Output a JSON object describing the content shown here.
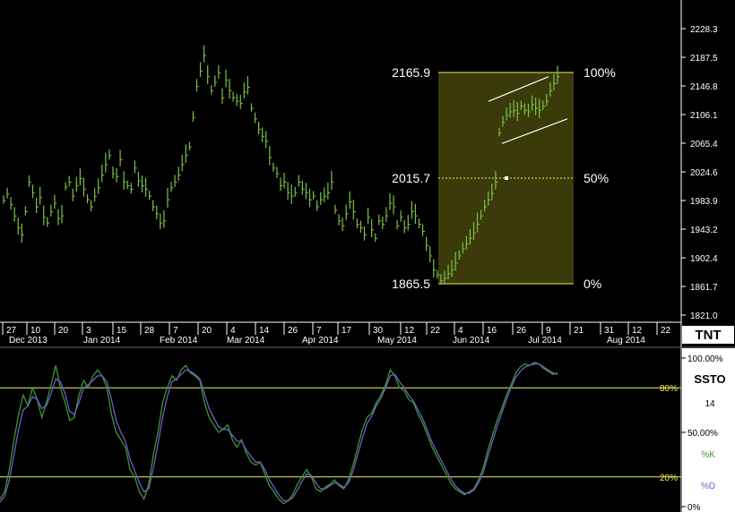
{
  "chart_data": [
    {
      "type": "bar",
      "style": "ohlc-bars",
      "bar_color": "#7cc24a",
      "ylim": [
        1821.0,
        2269.0
      ],
      "y_ticks": [
        "2228.3",
        "2187.5",
        "2146.8",
        "2106.1",
        "2065.4",
        "2024.6",
        "1983.9",
        "1943.2",
        "1902.4",
        "1861.7",
        "1821.0"
      ],
      "x_day_ticks": [
        "27",
        "10",
        "20",
        "3",
        "15",
        "28",
        "7",
        "20",
        "4",
        "14",
        "26",
        "7",
        "17",
        "30",
        "12",
        "22",
        "4",
        "16",
        "26",
        "9",
        "21",
        "31",
        "12",
        "22"
      ],
      "x_month_labels": [
        "Dec 2013",
        "Jan 2014",
        "Feb 2014",
        "Mar 2014",
        "Apr 2014",
        "May 2014",
        "Jun 2014",
        "Jul 2014",
        "Aug 2014"
      ],
      "fibonacci": {
        "levels": [
          {
            "price": "2165.9",
            "pct": "100%"
          },
          {
            "price": "2015.7",
            "pct": "50%"
          },
          {
            "price": "1865.5",
            "pct": "0%"
          }
        ],
        "zone_color": "#3a3a0a",
        "line_color": "#f0f060"
      },
      "channel": {
        "upper": [
          [
            2106.1,
            2165.9
          ]
        ],
        "lower": [
          [
            2065.4,
            2106.1
          ]
        ]
      },
      "price_series": [
        1983.9,
        1993,
        1978,
        1962,
        1945,
        1935,
        1968,
        2010,
        1995,
        1975,
        1988,
        1960,
        1952,
        1968,
        1980,
        1958,
        1962,
        2003,
        2010,
        1990,
        2005,
        2015,
        2000,
        1985,
        1975,
        1990,
        2002,
        2020,
        2035,
        2048,
        2022,
        2018,
        2042,
        2010,
        2005,
        2000,
        2030,
        2012,
        2005,
        2000,
        1990,
        1975,
        1965,
        1952,
        1955,
        1985,
        2002,
        2010,
        2020,
        2035,
        2048,
        2060,
        2102,
        2146,
        2168,
        2190,
        2160,
        2140,
        2152,
        2165,
        2130,
        2155,
        2140,
        2130,
        2125,
        2122,
        2138,
        2145,
        2115,
        2100,
        2085,
        2075,
        2068,
        2045,
        2030,
        2022,
        2005,
        2010,
        1995,
        1990,
        1995,
        2010,
        2000,
        1995,
        1985,
        1990,
        1975,
        1985,
        1990,
        1995,
        2010,
        1970,
        1955,
        1948,
        1965,
        1982,
        1968,
        1950,
        1945,
        1935,
        1960,
        1942,
        1930,
        1955,
        1950,
        1962,
        1980,
        1975,
        1948,
        1960,
        1945,
        1950,
        1968,
        1962,
        1950,
        1940,
        1920,
        1905,
        1885,
        1878,
        1870,
        1873,
        1880,
        1885,
        1895,
        1905,
        1915,
        1922,
        1930,
        1938,
        1950,
        1962,
        1975,
        1985,
        1994,
        2010,
        2080,
        2095,
        2105,
        2110,
        2112,
        2108,
        2118,
        2112,
        2110,
        2120,
        2115,
        2112,
        2118,
        2125,
        2140,
        2150,
        2160
      ]
    },
    {
      "type": "line",
      "name": "SSTO",
      "period": "14",
      "ylim": [
        0,
        100
      ],
      "y_ticks": [
        "100.00%",
        "50.00%",
        "0%"
      ],
      "level_lines": [
        {
          "value": 80,
          "label": "80%"
        },
        {
          "value": 20,
          "label": "20%"
        }
      ],
      "series": [
        {
          "name": "%K",
          "color": "#3c9a2a",
          "values": [
            5,
            10,
            25,
            45,
            62,
            75,
            68,
            80,
            72,
            60,
            70,
            82,
            95,
            80,
            70,
            58,
            60,
            75,
            85,
            80,
            88,
            92,
            88,
            80,
            62,
            50,
            45,
            40,
            25,
            20,
            10,
            5,
            15,
            35,
            50,
            70,
            80,
            88,
            85,
            92,
            95,
            90,
            88,
            85,
            70,
            60,
            55,
            50,
            52,
            55,
            45,
            40,
            45,
            36,
            30,
            28,
            30,
            22,
            14,
            10,
            5,
            2,
            4,
            8,
            15,
            20,
            25,
            20,
            12,
            10,
            13,
            15,
            18,
            14,
            12,
            18,
            28,
            40,
            52,
            60,
            63,
            70,
            75,
            82,
            92,
            88,
            80,
            78,
            72,
            70,
            62,
            56,
            48,
            40,
            34,
            28,
            22,
            16,
            12,
            10,
            8,
            10,
            12,
            18,
            26,
            38,
            48,
            58,
            66,
            75,
            82,
            90,
            94,
            96,
            95,
            97,
            96,
            93,
            91,
            89,
            90
          ]
        },
        {
          "name": "%D",
          "color": "#6a5fd0",
          "values": [
            3,
            7,
            18,
            35,
            52,
            65,
            68,
            74,
            72,
            66,
            68,
            76,
            86,
            84,
            76,
            64,
            62,
            70,
            80,
            82,
            85,
            88,
            88,
            84,
            72,
            58,
            50,
            44,
            32,
            24,
            16,
            10,
            12,
            26,
            42,
            60,
            74,
            84,
            86,
            89,
            92,
            91,
            89,
            86,
            76,
            66,
            60,
            54,
            52,
            52,
            48,
            44,
            44,
            38,
            34,
            30,
            30,
            25,
            18,
            13,
            8,
            4,
            4,
            6,
            11,
            17,
            22,
            21,
            16,
            12,
            12,
            14,
            16,
            15,
            13,
            16,
            24,
            35,
            46,
            56,
            61,
            68,
            73,
            80,
            88,
            89,
            84,
            80,
            75,
            71,
            65,
            59,
            51,
            43,
            37,
            31,
            25,
            19,
            14,
            11,
            9,
            9,
            11,
            16,
            23,
            34,
            44,
            54,
            63,
            72,
            80,
            87,
            91,
            94,
            95,
            96,
            96,
            94,
            92,
            90,
            89
          ]
        }
      ]
    }
  ],
  "panel": {
    "indicator_title": "SSTO",
    "indicator_period": "14",
    "legend_k": "%K",
    "legend_d": "%D",
    "brand": "TNT"
  },
  "colors": {
    "background": "#000000",
    "bars": "#7cc24a",
    "fib_line": "#f0f060",
    "fib_zone": "#3a3a0a",
    "k_line": "#3c9a2a",
    "d_line": "#6a5fd0",
    "panel_label_bg": "#ffffff",
    "panel_label_text": "#000000"
  }
}
